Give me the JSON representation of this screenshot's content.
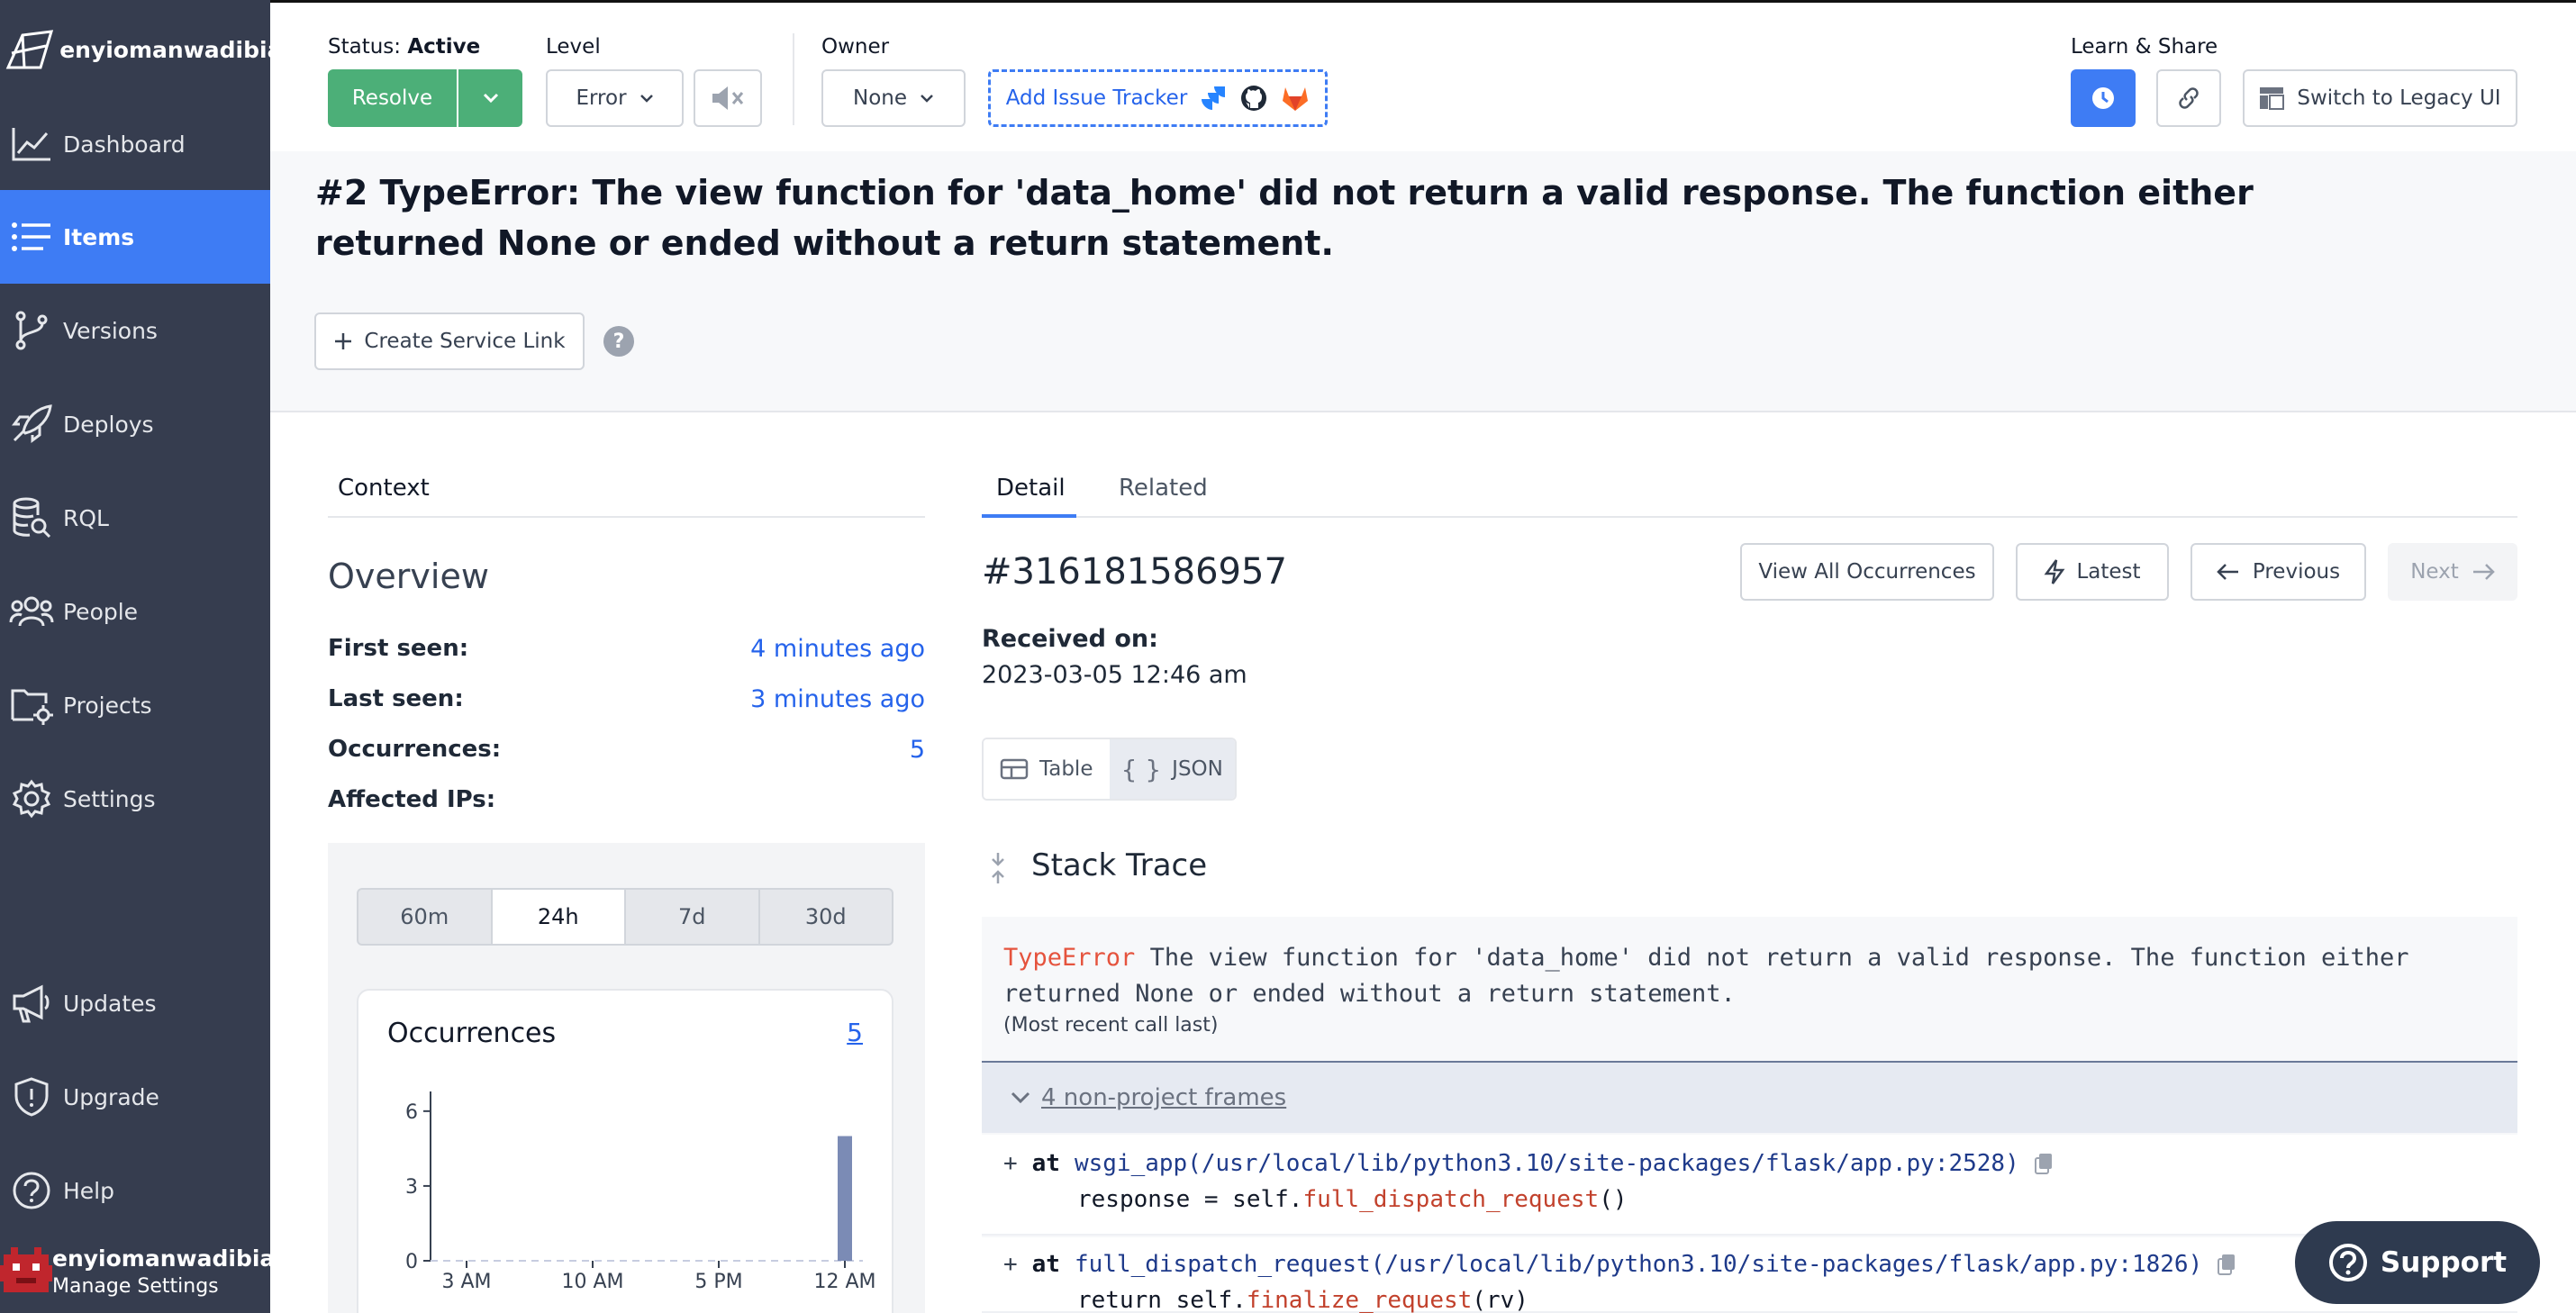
{
  "sidebar": {
    "brand": "enyiomanwadibia",
    "items": [
      {
        "label": "Dashboard",
        "icon": "chart-line-icon"
      },
      {
        "label": "Items",
        "icon": "list-icon"
      },
      {
        "label": "Versions",
        "icon": "branch-icon"
      },
      {
        "label": "Deploys",
        "icon": "rocket-icon"
      },
      {
        "label": "RQL",
        "icon": "database-search-icon"
      },
      {
        "label": "People",
        "icon": "people-icon"
      },
      {
        "label": "Projects",
        "icon": "folder-gear-icon"
      },
      {
        "label": "Settings",
        "icon": "gear-icon"
      },
      {
        "label": "Updates",
        "icon": "megaphone-icon"
      },
      {
        "label": "Upgrade",
        "icon": "shield-icon"
      },
      {
        "label": "Help",
        "icon": "question-icon"
      }
    ],
    "active": "Items",
    "user_name": "enyiomanwadibia",
    "manage_settings": "Manage Settings"
  },
  "header": {
    "status_label": "Status:",
    "status_value": "Active",
    "resolve_label": "Resolve",
    "level_label": "Level",
    "level_value": "Error",
    "owner_label": "Owner",
    "owner_value": "None",
    "add_tracker_label": "Add Issue Tracker",
    "learn_share_label": "Learn & Share",
    "legacy_label": "Switch to Legacy UI"
  },
  "issue": {
    "title": "#2 TypeError: The view function for 'data_home' did not return a valid response. The function either returned None or ended without a return statement.",
    "create_service_link": "Create Service Link",
    "help_icon": "?"
  },
  "context": {
    "tab": "Context",
    "overview_title": "Overview",
    "rows": [
      {
        "key": "First seen:",
        "value": "4 minutes ago"
      },
      {
        "key": "Last seen:",
        "value": "3 minutes ago"
      },
      {
        "key": "Occurrences:",
        "value": "5"
      },
      {
        "key": "Affected IPs:",
        "value": ""
      }
    ],
    "ranges": [
      "60m",
      "24h",
      "7d",
      "30d"
    ],
    "selected_range": "24h",
    "occ_card_title": "Occurrences",
    "occ_card_count": "5"
  },
  "chart_data": {
    "type": "bar",
    "title": "Occurrences",
    "y_ticks": [
      "0",
      "3",
      "6"
    ],
    "x_ticks": [
      "3 AM",
      "10 AM",
      "5 PM",
      "12 AM"
    ],
    "ylim": [
      0,
      6.5
    ],
    "categories": [
      "3 AM",
      "10 AM",
      "5 PM",
      "12 AM"
    ],
    "values": [
      0,
      0,
      0,
      5
    ],
    "bar_color": "#7b8bb5"
  },
  "detail": {
    "tabs": [
      "Detail",
      "Related"
    ],
    "selected_tab": "Detail",
    "occurrence_id": "#316181586957",
    "view_all": "View All Occurrences",
    "latest": "Latest",
    "previous": "Previous",
    "next": "Next",
    "received_label": "Received on:",
    "received_value": "2023-03-05 12:46 am",
    "view_table": "Table",
    "view_json": "JSON",
    "stack_trace_title": "Stack Trace",
    "error_type": "TypeError",
    "error_message": " The view function for 'data_home' did not return a valid response. The function either returned None or ended without a return statement.",
    "recent_note": "(Most recent call last)",
    "non_project_frames": "4 non-project frames",
    "frames": [
      {
        "plus": "+",
        "at": "at",
        "fn": "wsgi_app(/usr/local/lib/python3.10/site-packages/flask/app.py:2528)",
        "code_pre": "response = self.",
        "code_call": "full_dispatch_request",
        "code_post": "()"
      },
      {
        "plus": "+",
        "at": "at",
        "fn": "full_dispatch_request(/usr/local/lib/python3.10/site-packages/flask/app.py:1826)",
        "code_pre": "return self.",
        "code_call": "finalize_request",
        "code_post": "(rv)"
      }
    ]
  },
  "support": {
    "label": "Support"
  },
  "colors": {
    "sidebar": "#363d4f",
    "accent": "#3e7cf4",
    "resolve": "#4caf78",
    "error": "#e5533d"
  }
}
